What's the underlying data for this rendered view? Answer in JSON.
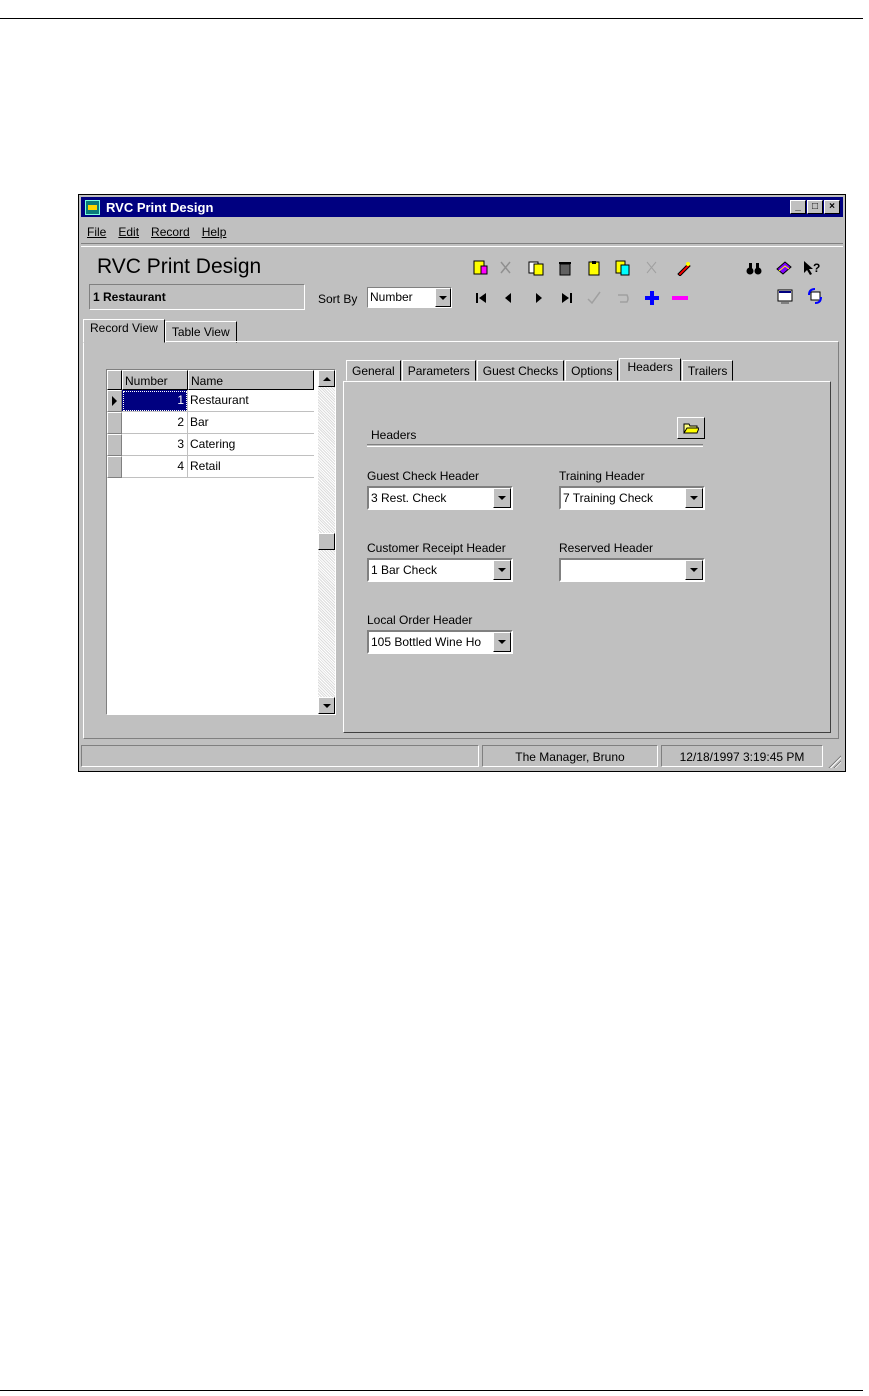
{
  "window": {
    "title": "RVC Print Design",
    "minimize": "_",
    "maximize": "□",
    "close": "×"
  },
  "menu": [
    "File",
    "Edit",
    "Record",
    "Help"
  ],
  "header": {
    "app_heading": "RVC Print Design",
    "current_record": "1 Restaurant",
    "sort_by_label": "Sort By",
    "sort_by_value": "Number"
  },
  "toolbar": {
    "icons": [
      "new-record-icon",
      "cut-icon",
      "copy-record-icon",
      "delete-icon",
      "paste-icon",
      "copy-icon",
      "undo-icon",
      "edit-icon",
      "find-icon",
      "book-icon",
      "help-pointer-icon",
      "first-record-icon",
      "prev-record-icon",
      "next-record-icon",
      "last-record-icon",
      "confirm-icon",
      "revert-icon",
      "add-record-icon",
      "remove-record-icon",
      "window-icon",
      "refresh-icon"
    ]
  },
  "outer_tabs": [
    "Record View",
    "Table View"
  ],
  "grid": {
    "columns": [
      "Number",
      "Name"
    ],
    "rows": [
      {
        "number": "1",
        "name": "Restaurant"
      },
      {
        "number": "2",
        "name": "Bar"
      },
      {
        "number": "3",
        "name": "Catering"
      },
      {
        "number": "4",
        "name": "Retail"
      }
    ]
  },
  "inner_tabs": [
    "General",
    "Parameters",
    "Guest Checks",
    "Options",
    "Headers",
    "Trailers"
  ],
  "headers_panel": {
    "group_title": "Headers",
    "guest_check_header": {
      "label": "Guest Check Header",
      "value": "3  Rest. Check"
    },
    "training_header": {
      "label": "Training Header",
      "value": "7  Training Check"
    },
    "customer_receipt_header": {
      "label": "Customer Receipt Header",
      "value": "1  Bar Check"
    },
    "reserved_header": {
      "label": "Reserved Header",
      "value": ""
    },
    "local_order_header": {
      "label": "Local Order Header",
      "value": "105  Bottled Wine Ho"
    }
  },
  "status": {
    "left": "",
    "user": "The Manager, Bruno",
    "datetime": "12/18/1997 3:19:45 PM"
  },
  "colors": {
    "titlebar": "#000080",
    "face": "#c0c0c0",
    "selection": "#000080"
  }
}
